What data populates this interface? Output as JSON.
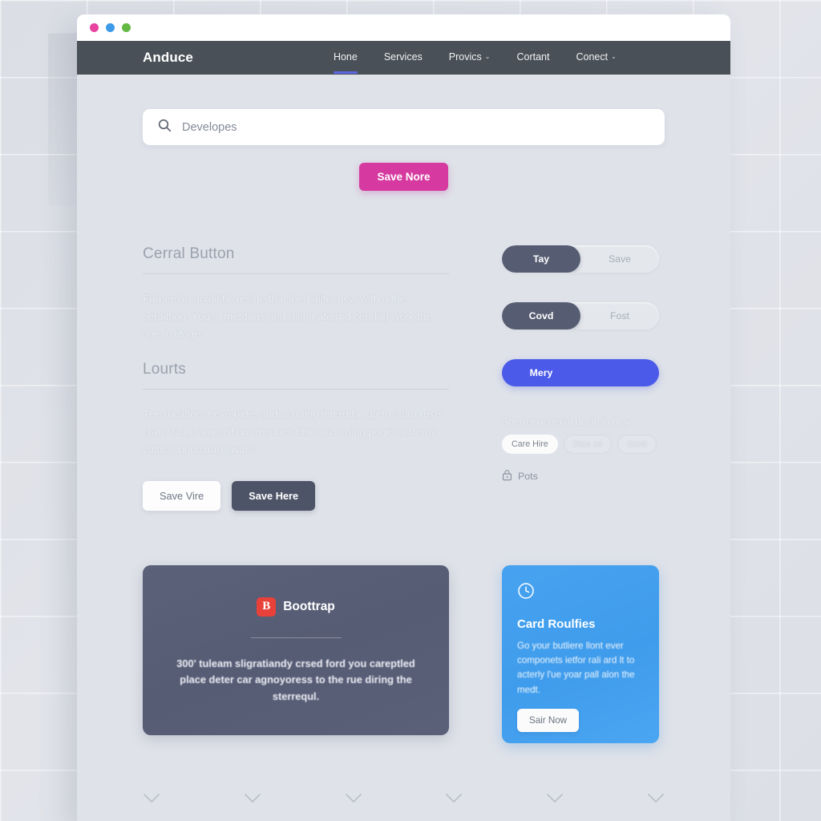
{
  "window": {
    "dots": [
      "window-dot-close",
      "window-dot-minimize",
      "window-dot-maximize"
    ]
  },
  "navbar": {
    "brand": "Anduce",
    "links": [
      {
        "label": "Hone",
        "caret": "",
        "active": true
      },
      {
        "label": "Services",
        "caret": "",
        "active": false
      },
      {
        "label": "Provics",
        "caret": "⌄",
        "active": false
      },
      {
        "label": "Cortant",
        "caret": "",
        "active": false
      },
      {
        "label": "Conect",
        "caret": "⌄",
        "active": false
      }
    ],
    "bg_color": "#495057",
    "active_underline_color": "#5b66e0"
  },
  "search": {
    "icon": "search-icon",
    "placeholder": "Developes",
    "value": ""
  },
  "cta": {
    "label": "Save Nore",
    "color": "#d6399f"
  },
  "left_column": {
    "section_one": {
      "title": "Cerral Button",
      "body": "Furners in acrdictle resige that iped alite, new with o the ceraittion. You s. metdags and roling ate grd cendap work the age in litage."
    },
    "section_two": {
      "title": "Lourts",
      "body": "The rocatlors heve pide, and apoaing interddar up to stour ruse crand solre amert if our moutles othe and coing pogel anderny vulticle bootstrap lavars."
    },
    "buttons": [
      {
        "label": "Save Vire",
        "style": "light"
      },
      {
        "label": "Save Here",
        "style": "dark"
      }
    ]
  },
  "right_column": {
    "toggles": [
      {
        "options": [
          "Tay",
          "Save"
        ],
        "selected": 0,
        "style": "split"
      },
      {
        "options": [
          "Covd",
          "Fost"
        ],
        "selected": 0,
        "style": "split"
      },
      {
        "options": [
          "Mery"
        ],
        "selected": 0,
        "style": "solid",
        "color": "#4b5ae8"
      }
    ],
    "note": "Sherter penerial decip in bley",
    "chips": [
      {
        "label": "Care Hire",
        "selected": true
      },
      {
        "label": "Sate us",
        "selected": false
      },
      {
        "label": "Saral",
        "selected": false
      }
    ],
    "lock_row": {
      "icon": "lock-icon",
      "label": "Pots"
    }
  },
  "cards": {
    "dark_card": {
      "badge_letter": "B",
      "badge_color": "#e8413a",
      "brand": "Boottrap",
      "body": "300' tuleam sligratiandy crsed ford you careptled place deter car agnoyoress to the rue diring the sterrequl."
    },
    "blue_card": {
      "icon": "clock-icon",
      "title": "Card Roulfies",
      "body": "Go your butliere llont ever componets ietfor rali ard lt to acterly l'ue yoar pall alon the medt.",
      "button_label": "Sair Now",
      "color": "#45a1ef"
    }
  },
  "footer": {
    "chevrons": [
      "chevron-down-icon-1",
      "chevron-down-icon-2",
      "chevron-down-icon-3",
      "chevron-down-icon-4",
      "chevron-down-icon-5",
      "chevron-down-icon-6"
    ]
  }
}
